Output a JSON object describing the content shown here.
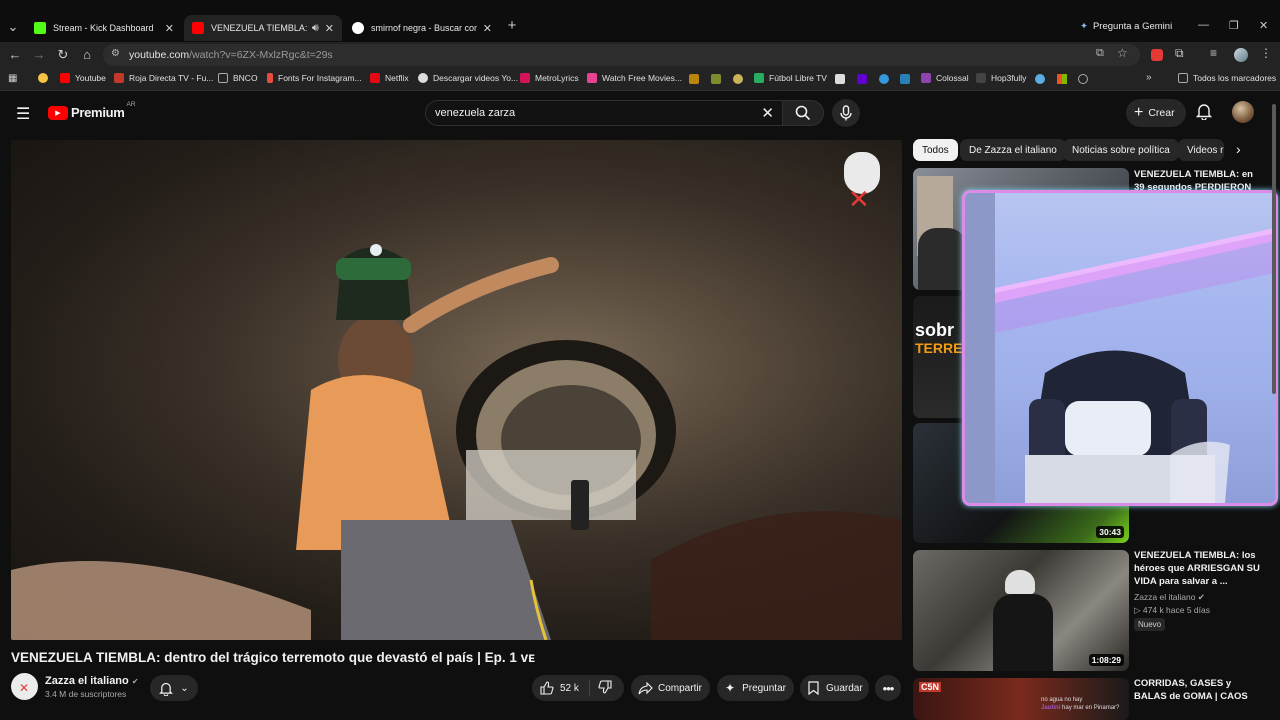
{
  "browser": {
    "tabs": [
      {
        "title": "Stream - Kick Dashboard",
        "color": "#53fc18"
      },
      {
        "title": "VENEZUELA TIEMBLA: dent",
        "color": "#ff0000"
      },
      {
        "title": "smirnof negra - Buscar con Goo",
        "color": "#4285f4"
      }
    ],
    "gemini_label": "Pregunta a Gemini",
    "url_main": "youtube.com",
    "url_path": "/watch?v=6ZX-MxlzRgc&t=29s",
    "bookmarks": [
      {
        "label": "Youtube",
        "color": "#ff0000"
      },
      {
        "label": "Roja Directa TV - Fu...",
        "color": "#c0392b"
      },
      {
        "label": "BNCO",
        "color": "#888888"
      },
      {
        "label": "Fonts For Instagram...",
        "color": "#e74c3c"
      },
      {
        "label": "Netflix",
        "color": "#e50914"
      },
      {
        "label": "Descargar videos Yo...",
        "color": "#dddddd"
      },
      {
        "label": "MetroLyrics",
        "color": "#d4145a"
      },
      {
        "label": "Watch Free Movies...",
        "color": "#e84393"
      },
      {
        "label": "Fútbol Libre TV",
        "color": "#27ae60"
      },
      {
        "label": "Colossal",
        "color": "#8e44ad"
      },
      {
        "label": "Hop3fully",
        "color": "#2d2d2d"
      }
    ],
    "all_bookmarks": "Todos los marcadores"
  },
  "youtube": {
    "logo_text": "Premium",
    "logo_badge": "AR",
    "search_value": "venezuela zarza",
    "create_label": "Crear",
    "chips": [
      "Todos",
      "De Zazza el italiano",
      "Noticias sobre política",
      "Videos re"
    ],
    "related": [
      {
        "title": "VENEZUELA TIEMBLA: en 39 segundos PERDIERON",
        "meta": "",
        "duration": ""
      },
      {
        "title": "",
        "meta": "",
        "duration": ""
      },
      {
        "title": "",
        "meta": "",
        "duration": "30:43"
      },
      {
        "title": "VENEZUELA TIEMBLA: los héroes que ARRIESGAN SU VIDA para salvar a ...",
        "channel": "Zazza el italiano",
        "meta": "▷ 474 k  hace 5 días",
        "badge": "Nuevo",
        "duration": "1:08:29"
      },
      {
        "title": "CORRIDAS, GASES y BALAS de GOMA | CAOS total en las",
        "duration": ""
      }
    ],
    "thumb_text_sobre": "sobr",
    "thumb_text_terremoto": "TERREM",
    "c5n_label": "C5N",
    "chat_line1": "no agua no hay",
    "chat_line2": "hay mar en Pinamar?",
    "chat_user": "Jautini",
    "video_title": "VENEZUELA TIEMBLA: dentro del trágico terremoto que devastó el país | Ep. 1 ᴠᴇ",
    "channel_name": "Zazza el italiano",
    "subscribers": "3.4 M de suscriptores",
    "likes": "52 k",
    "share_label": "Compartir",
    "ask_label": "Preguntar",
    "save_label": "Guardar"
  },
  "colors": {
    "accent_red": "#ff0000",
    "webcam_border": "#d98ce8",
    "led_strip": "#f3b9ff"
  }
}
